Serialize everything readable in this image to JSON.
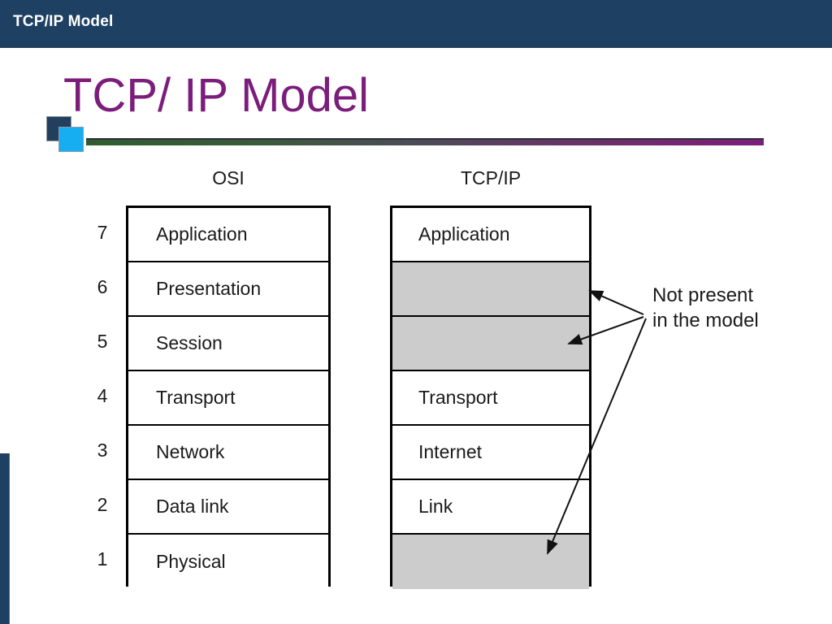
{
  "header": {
    "title": "TCP/IP Model",
    "bar_color": "#1e4062"
  },
  "slide": {
    "title": "TCP/ IP Model",
    "title_color": "#7b1d7b",
    "rule_start_color": "#2f5c2f",
    "rule_end_color": "#7b1d7b",
    "deco_square_dark_color": "#22405e",
    "deco_square_cyan_color": "#16aef0"
  },
  "diagram": {
    "osi": {
      "header": "OSI",
      "numbers": [
        "7",
        "6",
        "5",
        "4",
        "3",
        "2",
        "1"
      ],
      "layers": [
        {
          "label": "Application",
          "shaded": false
        },
        {
          "label": "Presentation",
          "shaded": false
        },
        {
          "label": "Session",
          "shaded": false
        },
        {
          "label": "Transport",
          "shaded": false
        },
        {
          "label": "Network",
          "shaded": false
        },
        {
          "label": "Data link",
          "shaded": false
        },
        {
          "label": "Physical",
          "shaded": false
        }
      ]
    },
    "tcpip": {
      "header": "TCP/IP",
      "layers": [
        {
          "label": "Application",
          "shaded": false
        },
        {
          "label": "",
          "shaded": true
        },
        {
          "label": "",
          "shaded": true
        },
        {
          "label": "Transport",
          "shaded": false
        },
        {
          "label": "Internet",
          "shaded": false
        },
        {
          "label": "Link",
          "shaded": false
        },
        {
          "label": "",
          "shaded": true
        }
      ]
    },
    "annotation": {
      "line1": "Not present",
      "line2": "in the model",
      "shaded_fill_color": "#cccccc"
    }
  }
}
